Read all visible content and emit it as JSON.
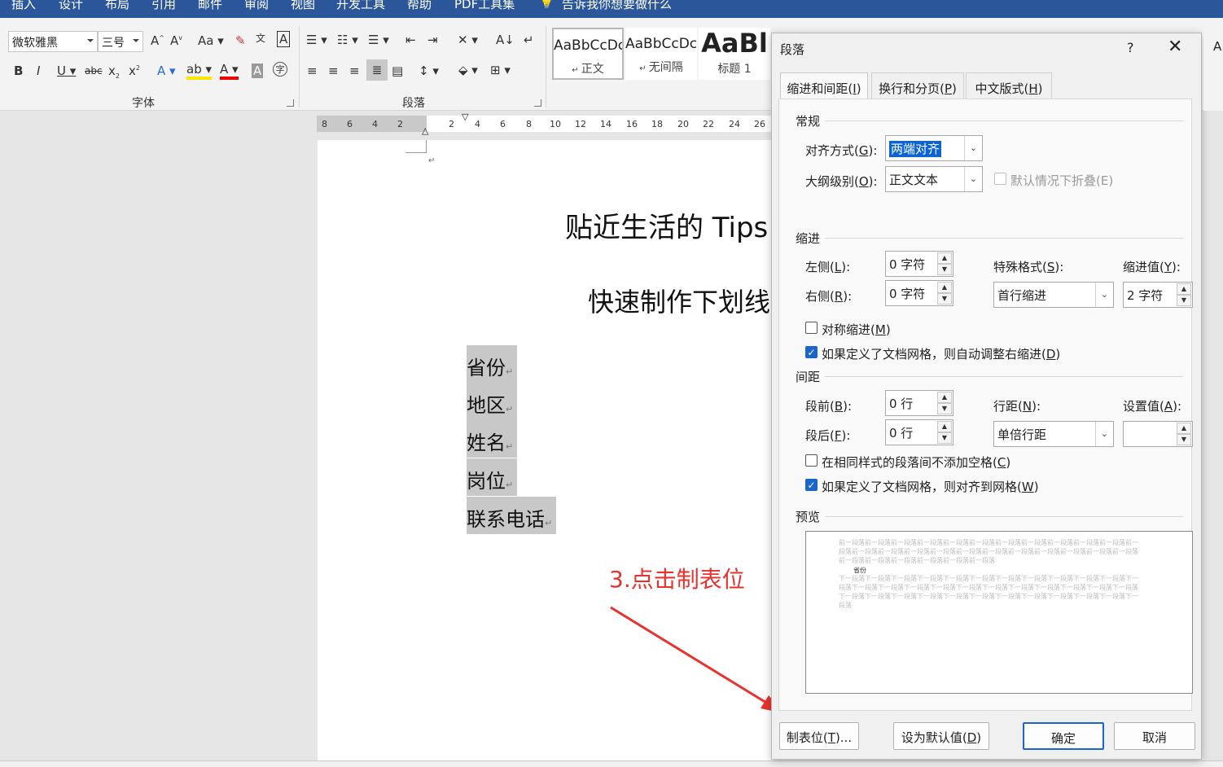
{
  "ribbon": {
    "tabs": [
      "插入",
      "设计",
      "布局",
      "引用",
      "邮件",
      "审阅",
      "视图",
      "开发工具",
      "帮助",
      "PDF工具集",
      "告诉我你想要做什么"
    ],
    "font": {
      "name": "微软雅黑",
      "size": "三号",
      "group_label": "字体"
    },
    "paragraph_group_label": "段落",
    "styles": [
      {
        "sample": "AaBbCcDc",
        "name": "正文"
      },
      {
        "sample": "AaBbCcDc",
        "name": "无间隔"
      },
      {
        "sample": "AaBl",
        "name": "标题 1"
      }
    ]
  },
  "ruler": {
    "numbers": [
      "8",
      "6",
      "4",
      "2",
      "2",
      "4",
      "6",
      "8",
      "10",
      "12",
      "14",
      "16",
      "18",
      "20",
      "22",
      "24",
      "26"
    ]
  },
  "document": {
    "title": "贴近生活的 Tips",
    "subtitle": "快速制作下划线",
    "lines": [
      "省份",
      "地区",
      "姓名",
      "岗位",
      "联系电话"
    ],
    "para_mark": "↵"
  },
  "annotation": {
    "text": "3.点击制表位"
  },
  "dialog": {
    "title": "段落",
    "help": "?",
    "close": "✕",
    "tabs": [
      {
        "label": "缩进和间距(",
        "key": "I",
        "suffix": ")"
      },
      {
        "label": "换行和分页(",
        "key": "P",
        "suffix": ")"
      },
      {
        "label": "中文版式(",
        "key": "H",
        "suffix": ")"
      }
    ],
    "general": {
      "heading": "常规",
      "alignment": {
        "label": "对齐方式(",
        "key": "G",
        "suffix": "):",
        "value": "两端对齐"
      },
      "outline": {
        "label": "大纲级别(",
        "key": "O",
        "suffix": "):",
        "value": "正文文本"
      },
      "collapse": {
        "label": "默认情况下折叠(E)",
        "checked": false
      }
    },
    "indent": {
      "heading": "缩进",
      "left": {
        "label": "左侧(",
        "key": "L",
        "suffix": "):",
        "value": "0 字符"
      },
      "right": {
        "label": "右侧(",
        "key": "R",
        "suffix": "):",
        "value": "0 字符"
      },
      "special": {
        "label": "特殊格式(",
        "key": "S",
        "suffix": "):",
        "value": "首行缩进"
      },
      "by": {
        "label": "缩进值(",
        "key": "Y",
        "suffix": "):",
        "value": "2 字符"
      },
      "mirror": {
        "label": "对称缩进(",
        "key": "M",
        "suffix": ")",
        "checked": false
      },
      "auto_right": {
        "label": "如果定义了文档网格，则自动调整右缩进(",
        "key": "D",
        "suffix": ")",
        "checked": true
      }
    },
    "spacing": {
      "heading": "间距",
      "before": {
        "label": "段前(",
        "key": "B",
        "suffix": "):",
        "value": "0 行"
      },
      "after": {
        "label": "段后(",
        "key": "F",
        "suffix": "):",
        "value": "0 行"
      },
      "line": {
        "label": "行距(",
        "key": "N",
        "suffix": "):",
        "value": "单倍行距"
      },
      "at": {
        "label": "设置值(",
        "key": "A",
        "suffix": "):",
        "value": ""
      },
      "no_space": {
        "label": "在相同样式的段落间不添加空格(",
        "key": "C",
        "suffix": ")",
        "checked": false
      },
      "snap_grid": {
        "label": "如果定义了文档网格，则对齐到网格(",
        "key": "W",
        "suffix": ")",
        "checked": true
      }
    },
    "preview": {
      "heading": "预览",
      "prev_text": "前一段落前一段落前一段落前一段落前一段落前一段落前一段落前一段落前一段落前一段落前一段落前一段落前一段落前一段落前一段落前一段落前一段落前一段落前一段落前一段落前一段落前一段落前一段落前一段落前一段落前一段落前一段落前一段落前一段落",
      "current_text": "省份",
      "next_text": "下一段落下一段落下一段落下一段落下一段落下一段落下一段落下一段落下一段落下一段落下一段落下一段落下一段落下一段落下一段落下一段落下一段落下一段落下一段落下一段落下一段落下一段落下一段落下一段落下一段落下一段落下一段落下一段落下一段落下一段落下一段落下一段落下一段落下一段落下一段落"
    },
    "buttons": {
      "tabs": {
        "label": "制表位(",
        "key": "T",
        "suffix": ")..."
      },
      "set_default": {
        "label": "设为默认值(",
        "key": "D",
        "suffix": ")"
      },
      "ok": "确定",
      "cancel": "取消"
    }
  }
}
